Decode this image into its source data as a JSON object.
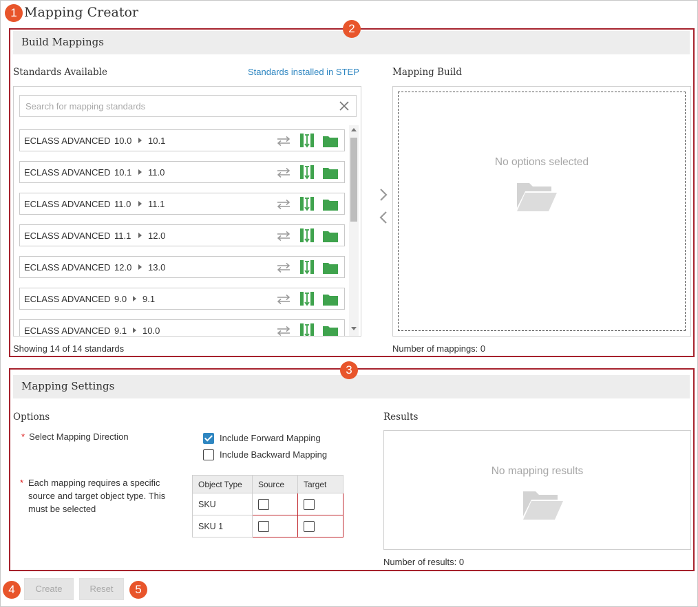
{
  "app": {
    "title": "Mapping Creator"
  },
  "callouts": [
    "1",
    "2",
    "3",
    "4",
    "5"
  ],
  "build": {
    "header": "Build Mappings",
    "standards_label": "Standards Available",
    "installed_link": "Standards installed in STEP",
    "search_placeholder": "Search for mapping standards",
    "standards": [
      {
        "name": "ECLASS ADVANCED",
        "from": "10.0",
        "to": "10.1"
      },
      {
        "name": "ECLASS ADVANCED",
        "from": "10.1",
        "to": "11.0"
      },
      {
        "name": "ECLASS ADVANCED",
        "from": "11.0",
        "to": "11.1"
      },
      {
        "name": "ECLASS ADVANCED",
        "from": "11.1",
        "to": "12.0"
      },
      {
        "name": "ECLASS ADVANCED",
        "from": "12.0",
        "to": "13.0"
      },
      {
        "name": "ECLASS ADVANCED",
        "from": "9.0",
        "to": "9.1"
      },
      {
        "name": "ECLASS ADVANCED",
        "from": "9.1",
        "to": "10.0"
      }
    ],
    "showing": "Showing 14 of 14 standards",
    "mapping_build_label": "Mapping Build",
    "empty_text": "No options selected",
    "mapping_count": "Number of mappings: 0",
    "icons": {
      "swap": "swap-arrows-icon",
      "map": "column-mapping-icon",
      "folder": "folder-icon",
      "clear": "close-icon"
    },
    "colors": {
      "green": "#3fa34d",
      "grey_icon": "#9a9a9a"
    }
  },
  "settings": {
    "header": "Mapping Settings",
    "options_label": "Options",
    "direction_label": "Select Mapping Direction",
    "forward_label": "Include Forward Mapping",
    "forward_checked": true,
    "backward_label": "Include Backward Mapping",
    "backward_checked": false,
    "object_type_note": "Each mapping requires a specific source and target object type. This must be selected",
    "table": {
      "headers": [
        "Object Type",
        "Source",
        "Target"
      ],
      "rows": [
        {
          "type": "SKU"
        },
        {
          "type": "SKU 1"
        }
      ]
    },
    "results_label": "Results",
    "results_empty": "No mapping results",
    "results_count": "Number of results: 0"
  },
  "actions": {
    "create": "Create",
    "reset": "Reset"
  },
  "colors": {
    "callout": "#e8552b",
    "annotation_border": "#a6222d",
    "link": "#2e86c1",
    "checkbox": "#2e86c1"
  }
}
